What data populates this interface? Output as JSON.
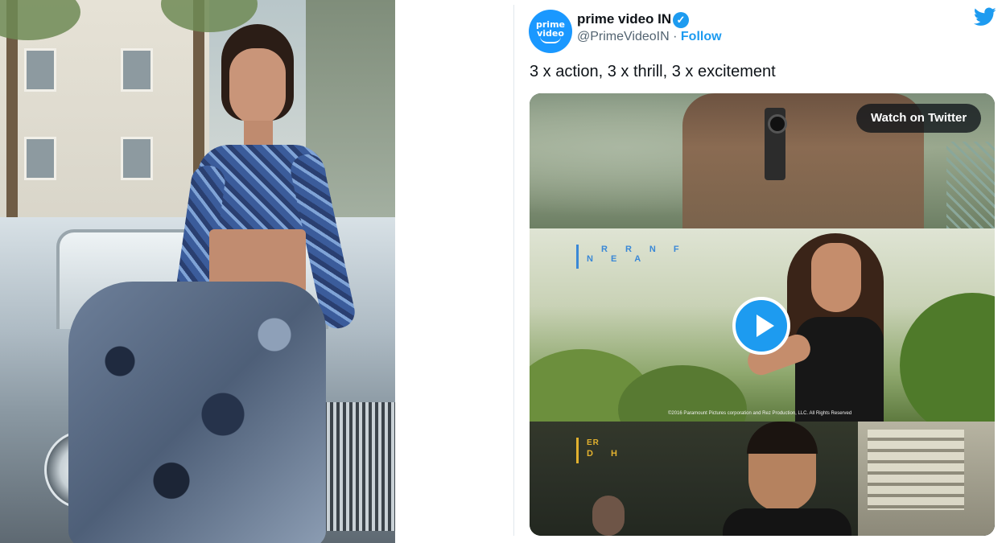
{
  "tweet": {
    "display_name": "prime video IN",
    "handle": "@PrimeVideoIN",
    "separator": "·",
    "follow_label": "Follow",
    "avatar_line1": "prime",
    "avatar_line2": "video",
    "text": "3 x action, 3 x thrill, 3 x excitement",
    "verified_glyph": "✓"
  },
  "media": {
    "watch_label": "Watch on Twitter",
    "frame2_title_line1": "RRNF",
    "frame2_title_line2": "NEA",
    "frame2_caption": "©2016 Paramount Pictures corporation and Rez Production, LLC. All Rights Reserved",
    "frame3_title_line1": "ER",
    "frame3_title_line2": "DH"
  },
  "icons": {
    "twitter": "twitter-bird-icon",
    "verified": "verified-badge-icon",
    "play": "play-icon"
  },
  "colors": {
    "twitter_blue": "#1d9bf0",
    "text": "#0f1419",
    "muted": "#536471",
    "avatar_blue": "#1a98ff"
  }
}
